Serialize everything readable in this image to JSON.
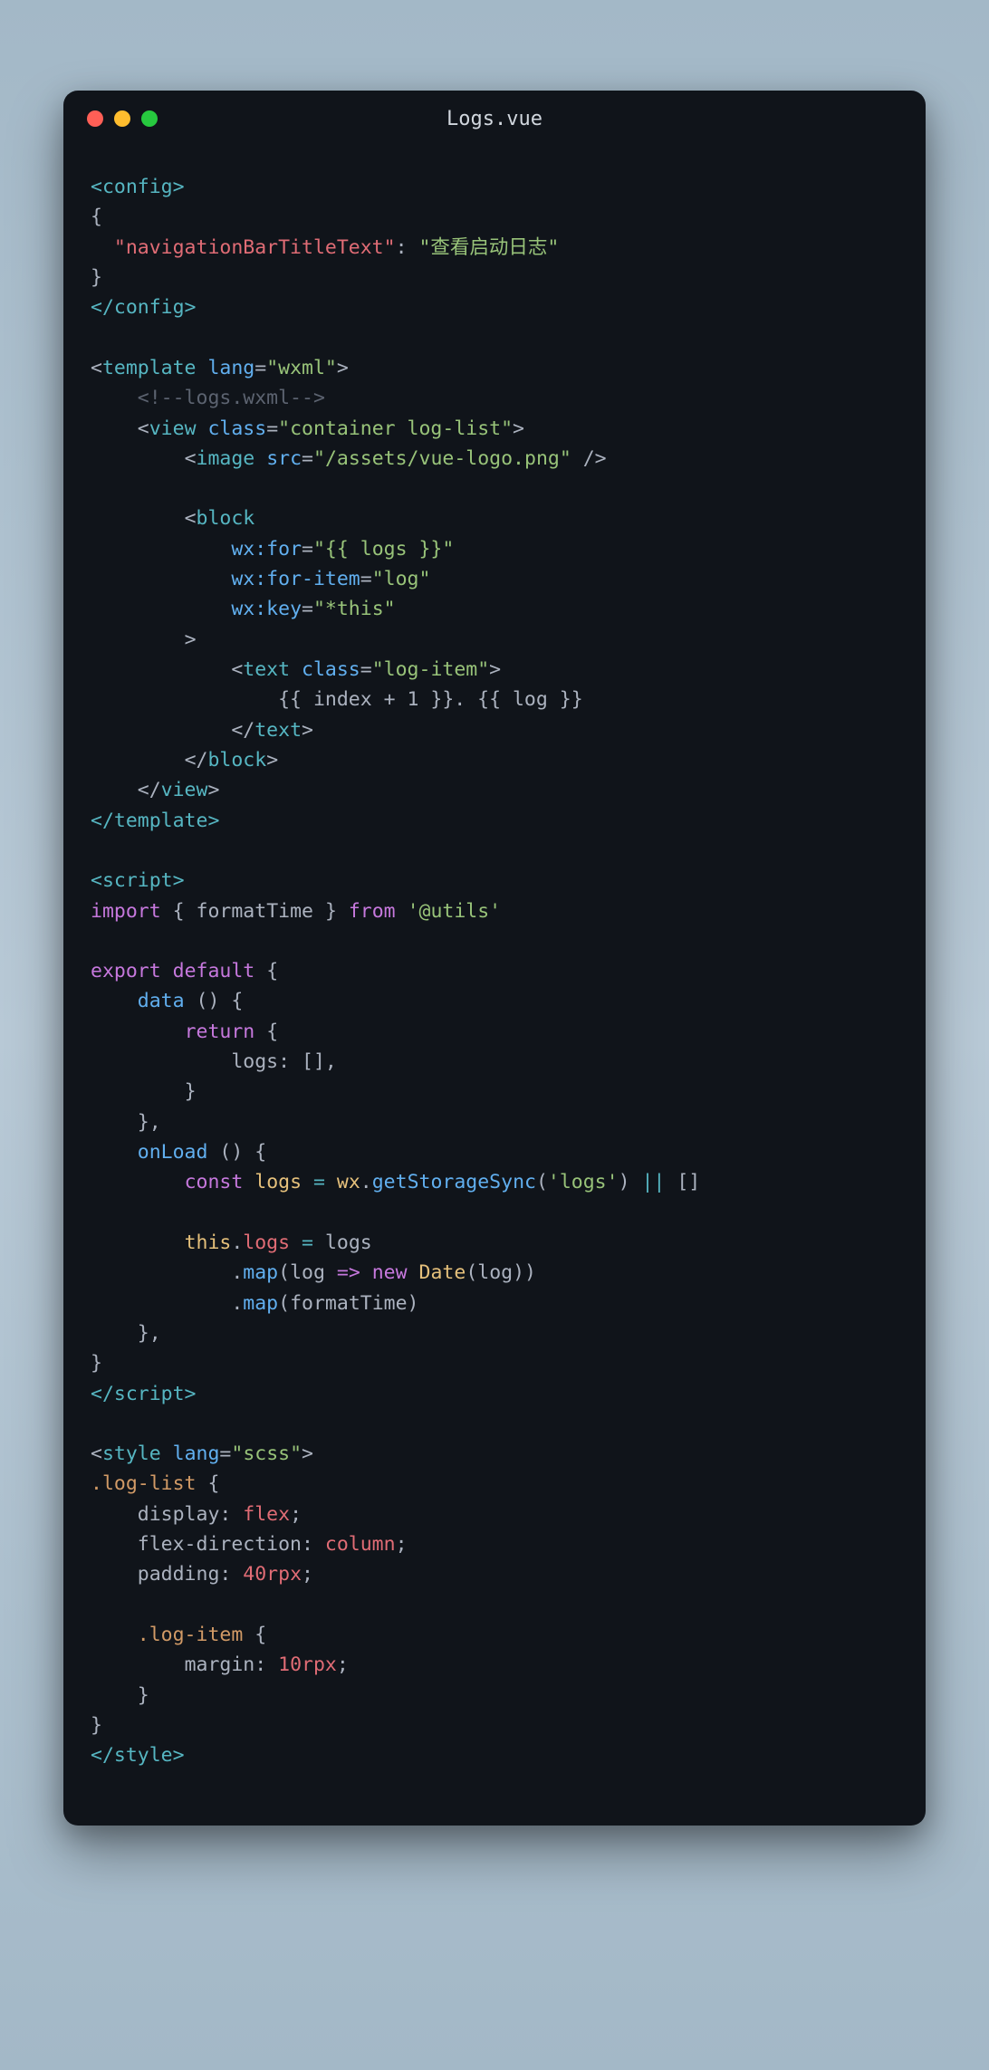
{
  "title": "Logs.vue",
  "code": {
    "config": {
      "open": "<config>",
      "brace_open": "{",
      "key": "\"navigationBarTitleText\"",
      "colon": ":",
      "value": "\"查看启动日志\"",
      "brace_close": "}",
      "close": "</config>"
    },
    "template": {
      "open_tag": "template",
      "lang_attr": "lang",
      "lang_val": "\"wxml\"",
      "comment": "<!--logs.wxml-->",
      "view_tag": "view",
      "class_attr": "class",
      "view_class": "\"container log-list\"",
      "image_tag": "image",
      "src_attr": "src",
      "src_val": "\"/assets/vue-logo.png\"",
      "block_tag": "block",
      "wxfor_attr": "wx:for",
      "wxfor_val": "\"{{ logs }}\"",
      "wxforitem_attr": "wx:for-item",
      "wxforitem_val": "\"log\"",
      "wxkey_attr": "wx:key",
      "wxkey_val": "\"*this\"",
      "text_tag": "text",
      "text_class": "\"log-item\"",
      "interp": "{{ index + 1 }}. {{ log }}",
      "close_template": "</template>"
    },
    "script": {
      "open": "<script>",
      "import_kw": "import",
      "import_name": "formatTime",
      "from_kw": "from",
      "from_val": "'@utils'",
      "export_kw": "export",
      "default_kw": "default",
      "data_fn": "data",
      "return_kw": "return",
      "logs_key": "logs",
      "empty_arr": "[]",
      "onload_fn": "onLoad",
      "const_kw": "const",
      "logs_var": "logs",
      "wx_obj": "wx",
      "getstorage_fn": "getStorageSync",
      "logs_str": "'logs'",
      "or_op": "||",
      "this_kw": "this",
      "logs_prop": "logs",
      "map_fn": "map",
      "log_arg": "log",
      "arrow": "=>",
      "new_kw": "new",
      "date_cls": "Date",
      "close": "</script>"
    },
    "style": {
      "open_tag": "style",
      "lang_attr": "lang",
      "lang_val": "\"scss\"",
      "sel1": ".log-list",
      "display_prop": "display",
      "flex_val": "flex",
      "flexdir_prop": "flex-direction",
      "column_val": "column",
      "padding_prop": "padding",
      "padding_val": "40rpx",
      "sel2": ".log-item",
      "margin_prop": "margin",
      "margin_val": "10rpx",
      "close": "</style>"
    }
  }
}
